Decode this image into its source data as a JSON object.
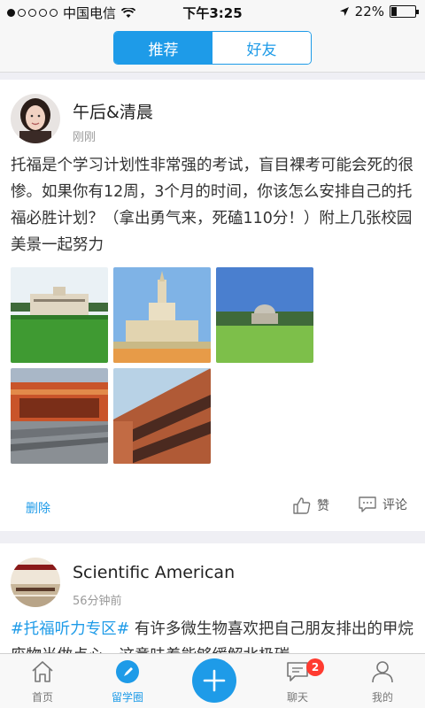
{
  "status_bar": {
    "carrier": "中国电信",
    "time": "下午3:25",
    "battery": "22%",
    "battery_level": 0.22,
    "signal_dots_filled": 1,
    "signal_dots_total": 5,
    "icons": [
      "signal-dots-icon",
      "wifi-icon",
      "location-arrow-icon",
      "battery-icon"
    ]
  },
  "header": {
    "tabs": [
      {
        "label": "推荐",
        "active": true
      },
      {
        "label": "好友",
        "active": false
      }
    ]
  },
  "posts": [
    {
      "author": "午后&清晨",
      "time": "刚刚",
      "text": "托福是个学习计划性非常强的考试，盲目裸考可能会死的很惨。如果你有12周，3个月的时间，你该怎么安排自己的托福必胜计划？（拿出勇气来，死磕110分！）附上几张校园美景一起努力",
      "photos": [
        "campus-building-photo",
        "tower-building-photo",
        "domed-hall-photo",
        "brick-arena-photo",
        "brick-building-photo"
      ],
      "delete_label": "删除",
      "like_label": "赞",
      "comment_label": "评论"
    },
    {
      "author": "Scientific American",
      "time": "56分钟前",
      "hashtag": "#托福听力专区#",
      "text": " 有许多微生物喜欢把自己朋友排出的甲烷废物当做点心，这意味着能够缓解北极碳"
    }
  ],
  "tabbar": {
    "items": [
      {
        "label": "首页",
        "icon": "home-icon",
        "active": false
      },
      {
        "label": "留学圈",
        "icon": "compass-icon",
        "active": true
      },
      {
        "label": "",
        "icon": "plus-icon",
        "active": false
      },
      {
        "label": "聊天",
        "icon": "chat-icon",
        "active": false
      },
      {
        "label": "我的",
        "icon": "profile-icon",
        "active": false
      }
    ],
    "chat_badge": "2"
  },
  "colors": {
    "accent": "#1e9be8",
    "badge": "#ff3b30",
    "background": "#efeff4"
  }
}
